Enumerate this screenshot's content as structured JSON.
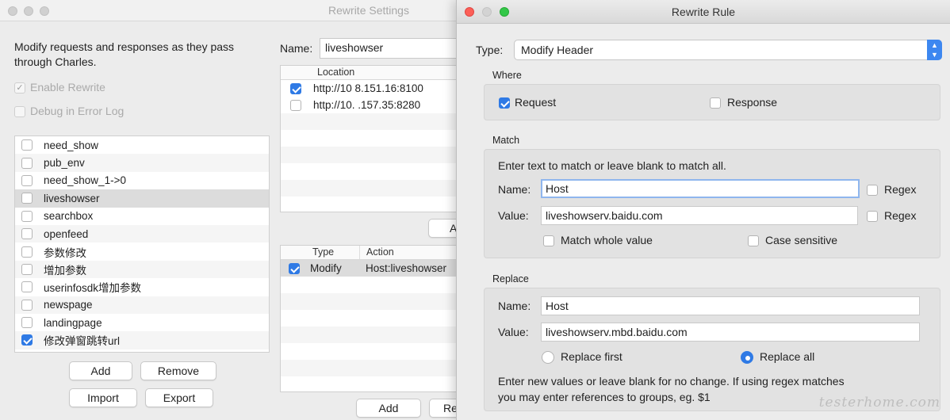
{
  "back_window": {
    "title": "Rewrite Settings",
    "intro": "Modify requests and responses as they pass through Charles.",
    "enable_rewrite": "Enable Rewrite",
    "debug_log": "Debug in Error Log",
    "rules": [
      {
        "label": "need_show",
        "checked": false
      },
      {
        "label": "pub_env",
        "checked": false
      },
      {
        "label": "need_show_1->0",
        "checked": false
      },
      {
        "label": "liveshowser",
        "checked": false
      },
      {
        "label": "searchbox",
        "checked": false
      },
      {
        "label": "openfeed",
        "checked": false
      },
      {
        "label": "参数修改",
        "checked": false
      },
      {
        "label": "增加参数",
        "checked": false
      },
      {
        "label": "userinfosdk增加参数",
        "checked": false
      },
      {
        "label": "newspage",
        "checked": false
      },
      {
        "label": "landingpage",
        "checked": false
      },
      {
        "label": "修改弹窗跳转url",
        "checked": true
      }
    ],
    "add": "Add",
    "remove": "Remove",
    "import": "Import",
    "export": "Export",
    "name_label": "Name:",
    "name_value": "liveshowser",
    "location_header": "Location",
    "locations": [
      {
        "url": "http://10    8.151.16:8100",
        "checked": true
      },
      {
        "url": "http://10.   .157.35:8280",
        "checked": false
      }
    ],
    "loc_add_partial": "A",
    "type_header": "Type",
    "action_header": "Action",
    "rule_rows": [
      {
        "type": "Modify",
        "action": "Host:liveshowser",
        "checked": true
      }
    ],
    "bottom_add": "Add",
    "bottom_partial": "Re"
  },
  "rewrite_rule": {
    "title": "Rewrite Rule",
    "type_label": "Type:",
    "type_value": "Modify Header",
    "where_label": "Where",
    "request": "Request",
    "response": "Response",
    "match_label": "Match",
    "match_hint": "Enter text to match or leave blank to match all.",
    "name_label": "Name:",
    "match_name": "Host",
    "value_label": "Value:",
    "match_value": "liveshowserv.baidu.com",
    "regex": "Regex",
    "match_whole": "Match whole value",
    "case_sensitive": "Case sensitive",
    "replace_label": "Replace",
    "replace_name": "Host",
    "replace_value": "liveshowserv.mbd.baidu.com",
    "replace_first": "Replace first",
    "replace_all": "Replace all",
    "replace_hint_1": "Enter new values or leave blank for no change. If using regex matches",
    "replace_hint_2": "you may enter references to groups, eg. $1"
  },
  "watermark": "testerhome.com"
}
